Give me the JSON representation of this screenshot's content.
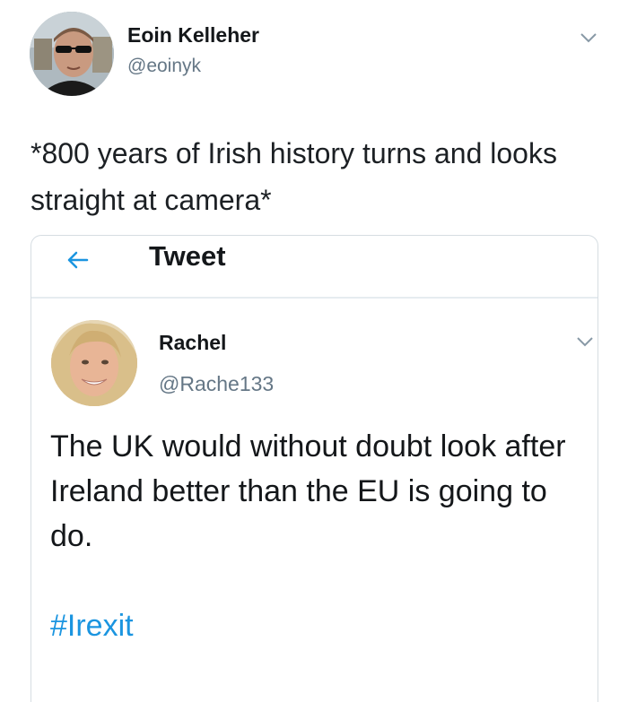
{
  "outer_tweet": {
    "author_name": "Eoin Kelleher",
    "author_handle": "@eoinyk",
    "text": "*800 years of Irish history turns and looks straight at camera*",
    "menu_icon": "chevron-down-icon"
  },
  "quoted_screenshot": {
    "header": {
      "back_icon": "back-arrow-icon",
      "title": "Tweet"
    },
    "tweet": {
      "author_name": "Rachel",
      "author_handle": "@Rache133",
      "text": "The UK would without doubt look after Ireland better than the EU is going to do.",
      "hashtag": "#Irexit",
      "menu_icon": "chevron-down-icon"
    }
  },
  "colors": {
    "link_blue": "#1b95e0",
    "secondary_text": "#657786",
    "divider": "#e6ecf0"
  }
}
